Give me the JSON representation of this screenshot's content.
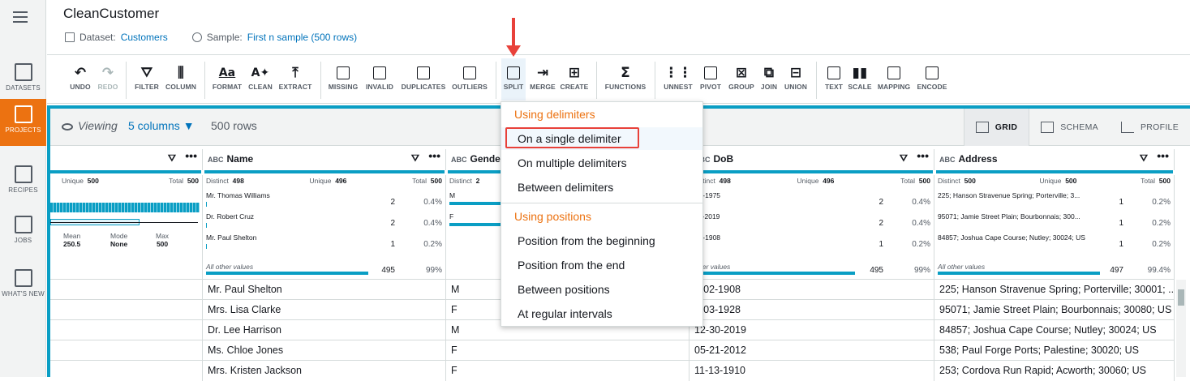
{
  "nav": {
    "items": [
      {
        "label": "DATASETS",
        "active": false
      },
      {
        "label": "PROJECTS",
        "active": true
      },
      {
        "label": "RECIPES",
        "active": false
      },
      {
        "label": "JOBS",
        "active": false
      },
      {
        "label": "WHAT'S NEW",
        "active": false
      }
    ]
  },
  "header": {
    "title": "CleanCustomer",
    "dataset_label": "Dataset:",
    "dataset_value": "Customers",
    "sample_label": "Sample:",
    "sample_value": "First n sample (500 rows)"
  },
  "toolbar": {
    "undo": "UNDO",
    "redo": "REDO",
    "filter": "FILTER",
    "column": "COLUMN",
    "format": "FORMAT",
    "clean": "CLEAN",
    "extract": "EXTRACT",
    "missing": "MISSING",
    "invalid": "INVALID",
    "duplicates": "DUPLICATES",
    "outliers": "OUTLIERS",
    "split": "SPLIT",
    "merge": "MERGE",
    "create": "CREATE",
    "functions": "FUNCTIONS",
    "unnest": "UNNEST",
    "pivot": "PIVOT",
    "group": "GROUP",
    "join": "JOIN",
    "union": "UNION",
    "text": "TEXT",
    "scale": "SCALE",
    "mapping": "MAPPING",
    "encode": "ENCODE"
  },
  "viewbar": {
    "viewing": "Viewing",
    "columns": "5 columns",
    "rows": "500 rows",
    "tabs": {
      "grid": "GRID",
      "schema": "SCHEMA",
      "profile": "PROFILE"
    }
  },
  "columns": {
    "first": {
      "unique_label": "Unique",
      "unique": "500",
      "total_label": "Total",
      "total": "500",
      "mean_label": "Mean",
      "mean": "250.5",
      "mode_label": "Mode",
      "mode": "None",
      "max_label": "Max",
      "max": "500"
    },
    "name": {
      "type": "ABC",
      "title": "Name",
      "distinct_label": "Distinct",
      "distinct": "498",
      "unique_label": "Unique",
      "unique": "496",
      "total_label": "Total",
      "total": "500",
      "values": [
        {
          "v": "Mr. Thomas Williams",
          "c": "2",
          "p": "0.4%"
        },
        {
          "v": "Dr. Robert Cruz",
          "c": "2",
          "p": "0.4%"
        },
        {
          "v": "Mr. Paul Shelton",
          "c": "1",
          "p": "0.2%"
        }
      ],
      "other_label": "All other values",
      "other_count": "495",
      "other_pct": "99%"
    },
    "gender": {
      "type": "ABC",
      "title": "Gende",
      "distinct_label": "Distinct",
      "distinct": "2",
      "values": [
        "M",
        "F"
      ]
    },
    "dob": {
      "type": "ABC",
      "title": "DoB",
      "distinct_label": "Distinct",
      "distinct": "498",
      "unique_label": "Unique",
      "unique": "496",
      "total_label": "Total",
      "total": "500",
      "values": [
        {
          "v": "-29-1975",
          "c": "2",
          "p": "0.4%"
        },
        {
          "v": "-11-2019",
          "c": "2",
          "p": "0.4%"
        },
        {
          "v": "-02-1908",
          "c": "1",
          "p": "0.2%"
        }
      ],
      "other_label": "other values",
      "other_count": "495",
      "other_pct": "99%"
    },
    "address": {
      "type": "ABC",
      "title": "Address",
      "distinct_label": "Distinct",
      "distinct": "500",
      "unique_label": "Unique",
      "unique": "500",
      "total_label": "Total",
      "total": "500",
      "values": [
        {
          "v": "225; Hanson Stravenue Spring; Porterville; 3...",
          "c": "1",
          "p": "0.2%"
        },
        {
          "v": "95071; Jamie Street Plain; Bourbonnais; 300...",
          "c": "1",
          "p": "0.2%"
        },
        {
          "v": "84857; Joshua Cape Course; Nutley; 30024; US",
          "c": "1",
          "p": "0.2%"
        }
      ],
      "other_label": "All other values",
      "other_count": "497",
      "other_pct": "99.4%"
    }
  },
  "rows": [
    {
      "name": "Mr. Paul Shelton",
      "gender": "M",
      "dob": "1-02-1908",
      "address": "225; Hanson Stravenue Spring; Porterville; 30001; ..."
    },
    {
      "name": "Mrs. Lisa Clarke",
      "gender": "F",
      "dob": "5-03-1928",
      "address": "95071; Jamie Street Plain; Bourbonnais; 30080; US"
    },
    {
      "name": "Dr. Lee Harrison",
      "gender": "M",
      "dob": "12-30-2019",
      "address": "84857; Joshua Cape Course; Nutley; 30024; US"
    },
    {
      "name": "Ms. Chloe Jones",
      "gender": "F",
      "dob": "05-21-2012",
      "address": "538; Paul Forge Ports; Palestine; 30020; US"
    },
    {
      "name": "Mrs. Kristen Jackson",
      "gender": "F",
      "dob": "11-13-1910",
      "address": "253; Cordova Run Rapid; Acworth; 30060; US"
    }
  ],
  "menu": {
    "section1": "Using delimiters",
    "items1": [
      "On a single delimiter",
      "On multiple delimiters",
      "Between delimiters"
    ],
    "section2": "Using positions",
    "items2": [
      "Position from the beginning",
      "Position from the end",
      "Between positions",
      "At regular intervals"
    ]
  },
  "colors": {
    "accent": "#ec7211",
    "link": "#0073bb",
    "band": "#0a9ec4",
    "annotation": "#e8413a"
  }
}
